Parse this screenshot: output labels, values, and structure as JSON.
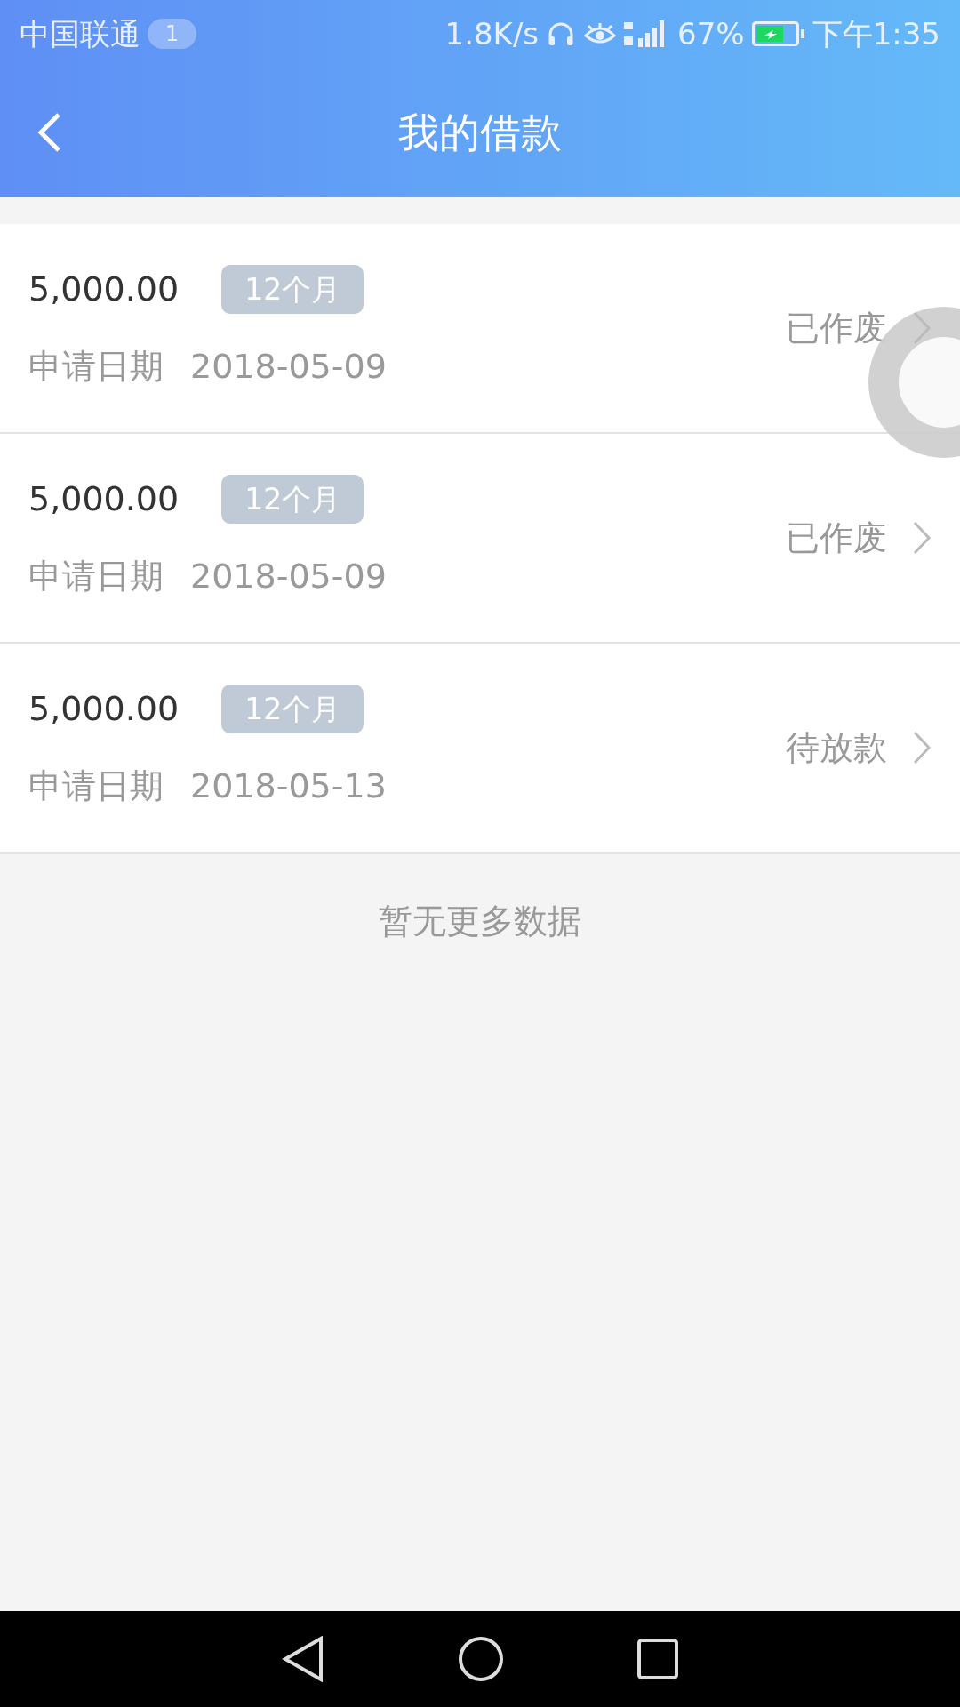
{
  "status_bar": {
    "carrier": "中国联通",
    "notification_count": "1",
    "speed": "1.8K/s",
    "battery": "67%",
    "time": "下午1:35"
  },
  "header": {
    "title": "我的借款"
  },
  "loans": [
    {
      "amount": "5,000.00",
      "term": "12个月",
      "date_label": "申请日期",
      "date": "2018-05-09",
      "status": "已作废"
    },
    {
      "amount": "5,000.00",
      "term": "12个月",
      "date_label": "申请日期",
      "date": "2018-05-09",
      "status": "已作废"
    },
    {
      "amount": "5,000.00",
      "term": "12个月",
      "date_label": "申请日期",
      "date": "2018-05-13",
      "status": "待放款"
    }
  ],
  "footer_note": "暂无更多数据"
}
